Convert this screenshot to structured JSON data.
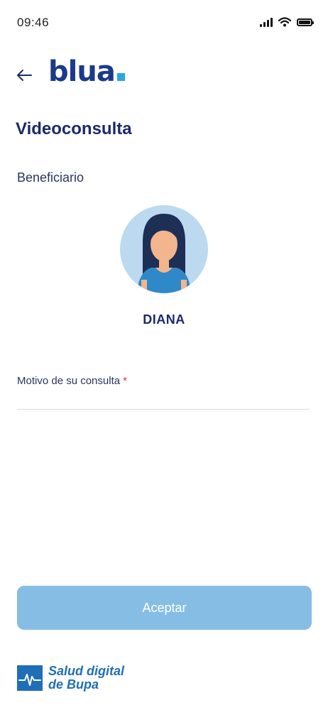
{
  "status_bar": {
    "time": "09:46"
  },
  "header": {
    "logo_text": "blua",
    "back_icon": "arrow-left-icon"
  },
  "page": {
    "title": "Videoconsulta",
    "beneficiary_label": "Beneficiario"
  },
  "beneficiary": {
    "name": "DIANA",
    "avatar_icon": "woman-avatar"
  },
  "form": {
    "reason_label": "Motivo de su consulta",
    "required_mark": "*",
    "reason_value": "",
    "reason_placeholder": ""
  },
  "actions": {
    "accept_label": "Aceptar"
  },
  "footer": {
    "line1": "Salud digital",
    "line2": "de Bupa"
  },
  "colors": {
    "accent": "#86bde5",
    "brand_dark": "#1b3a8a",
    "logo_dot": "#2aa8e0",
    "required": "#e0342f",
    "footer_text": "#1f6fb8"
  }
}
